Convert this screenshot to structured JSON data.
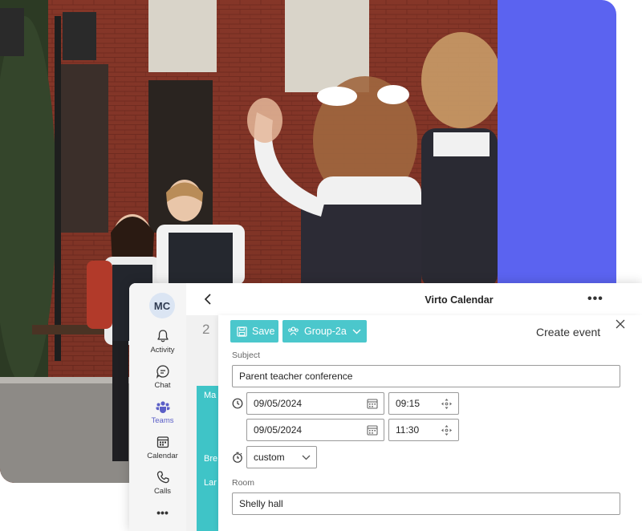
{
  "colors": {
    "accent": "#4bc7cc",
    "brand_panel": "#5b63f0",
    "teams_purple": "#5b5fc7"
  },
  "window": {
    "title": "Virto Calendar",
    "more_label": "•••"
  },
  "user": {
    "initials": "MC"
  },
  "rail": [
    {
      "label": "Activity",
      "icon": "bell-icon"
    },
    {
      "label": "Chat",
      "icon": "chat-icon"
    },
    {
      "label": "Teams",
      "icon": "teams-icon",
      "active": true
    },
    {
      "label": "Calendar",
      "icon": "calendar-icon"
    },
    {
      "label": "Calls",
      "icon": "phone-icon"
    },
    {
      "label": "•••",
      "icon": "more-icon"
    }
  ],
  "calendar_bg": {
    "day": "2",
    "events": [
      "Ma",
      "Bre",
      "Lar"
    ]
  },
  "dialog": {
    "title": "Create event",
    "save_label": "Save",
    "group_label": "Group-2a",
    "subject_label": "Subject",
    "subject_value": "Parent teacher conference",
    "start_date": "09/05/2024",
    "start_time": "09:15",
    "end_date": "09/05/2024",
    "end_time": "11:30",
    "recurrence": "custom",
    "room_label": "Room",
    "room_value": "Shelly hall"
  }
}
